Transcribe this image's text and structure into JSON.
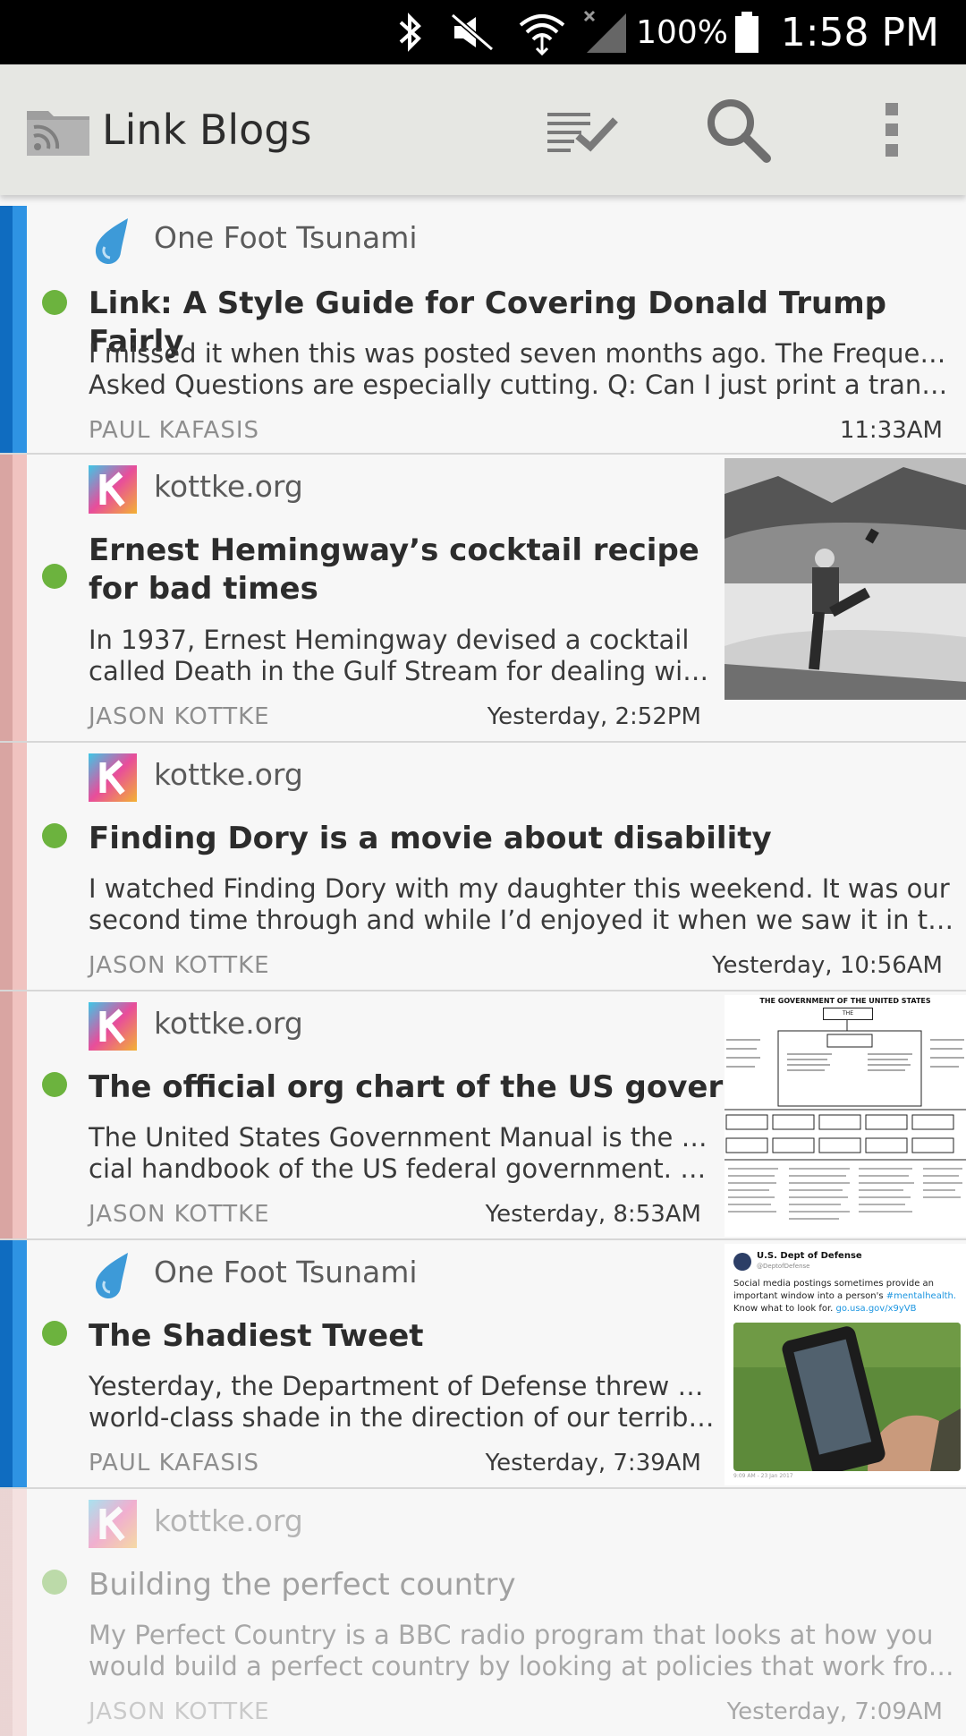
{
  "status_bar": {
    "battery_text": "100%",
    "time": "1:58 PM",
    "icons": [
      "bluetooth-icon",
      "mute-icon",
      "wifi-icon",
      "signal-icon",
      "battery-icon"
    ]
  },
  "app_bar": {
    "title": "Link Blogs",
    "icons": [
      "folder-rss-icon",
      "mark-all-read-icon",
      "search-icon",
      "overflow-menu-icon"
    ]
  },
  "colors": {
    "blue_stripe": "#1a7fd8",
    "pink_stripe": "#e8a7a7",
    "unread_dot": "#6cb33e"
  },
  "items": [
    {
      "feed": "One Foot Tsunami",
      "feed_icon": "water-drop-icon",
      "headline": "Link: A Style Guide for Covering Donald Trump Fairly",
      "summary_line1": "I missed it when this was posted seven months ago. The Frequently",
      "summary_line2": "Asked Questions are especially cutting.  Q: Can I just print a transcript...",
      "author": "PAUL KAFASIS",
      "time": "11:33AM"
    },
    {
      "feed": "kottke.org",
      "feed_icon": "kottke-k-icon",
      "headline": "Ernest Hemingway’s cocktail recipe for bad times",
      "summary_line1": "In 1937, Ernest Hemingway devised a cocktail",
      "summary_line2": "called Death in the Gulf Stream for dealing with h...",
      "author": "JASON KOTTKE",
      "time": "Yesterday, 2:52PM",
      "thumbnail": "hemingway-photo"
    },
    {
      "feed": "kottke.org",
      "feed_icon": "kottke-k-icon",
      "headline": "Finding Dory is a movie about disability",
      "summary_line1": "I watched Finding Dory with my daughter this weekend. It was our",
      "summary_line2": "second time through and while I’d enjoyed it when we saw it in the th...",
      "author": "JASON KOTTKE",
      "time": "Yesterday, 10:56AM"
    },
    {
      "feed": "kottke.org",
      "feed_icon": "kottke-k-icon",
      "headline": "The official org chart of the US government",
      "summary_line1": "The United States Government Manual is the offi-",
      "summary_line2": "cial handbook of the US federal government. Here...",
      "author": "JASON KOTTKE",
      "time": "Yesterday, 8:53AM",
      "thumbnail": "org-chart",
      "thumb_title": "THE GOVERNMENT OF THE UNITED STATES",
      "thumb_box": "THE CONSTITUTION"
    },
    {
      "feed": "One Foot Tsunami",
      "feed_icon": "water-drop-icon",
      "headline": "The Shadiest Tweet",
      "summary_line1": "Yesterday, the Department of Defense threw some",
      "summary_line2": "world-class shade in the direction of our terrible ...",
      "author": "PAUL KAFASIS",
      "time": "Yesterday, 7:39AM",
      "thumbnail": "tweet",
      "tweet_account": "U.S. Dept of Defense",
      "tweet_handle": "@DeptofDefense",
      "tweet_text_1": "Social media postings sometimes provide an",
      "tweet_text_2": "important window into a person's ",
      "tweet_hashtag": "#mentalhealth.",
      "tweet_text_3": "Know what to look for. ",
      "tweet_link": "go.usa.gov/x9yVB",
      "tweet_date": "9:09 AM - 23 Jan 2017"
    },
    {
      "feed": "kottke.org",
      "feed_icon": "kottke-k-icon",
      "headline": "Building the perfect country",
      "summary_line1": "My Perfect Country is a BBC radio program that looks at how you",
      "summary_line2": "would build a perfect country by looking at policies that work from c...",
      "author": "JASON KOTTKE",
      "time": "Yesterday, 7:09AM"
    }
  ]
}
